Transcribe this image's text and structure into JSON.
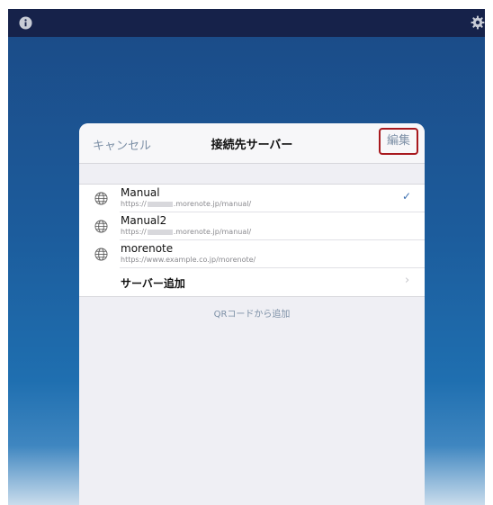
{
  "colors": {
    "topbar": "#16224a",
    "background_accent": "#1c5c9c",
    "link_text": "#7d90a6",
    "highlight_border": "#a8191e",
    "checkmark": "#3b6fb0"
  },
  "topbar": {
    "left_icon": "info-icon",
    "right_icon": "gear-icon"
  },
  "dialog": {
    "cancel_label": "キャンセル",
    "title": "接続先サーバー",
    "edit_label": "編集",
    "servers": [
      {
        "name": "Manual",
        "url_prefix": "https://",
        "url_suffix": ".morenote.jp/manual/",
        "redacted": true,
        "selected": true
      },
      {
        "name": "Manual2",
        "url_prefix": "https://",
        "url_suffix": ".morenote.jp/manual/",
        "redacted": true,
        "selected": false
      },
      {
        "name": "morenote",
        "url_prefix": "https://www.example.co.jp/morenote/",
        "url_suffix": "",
        "redacted": false,
        "selected": false
      }
    ],
    "add_server_label": "サーバー追加",
    "qr_add_label": "QRコードから追加"
  }
}
